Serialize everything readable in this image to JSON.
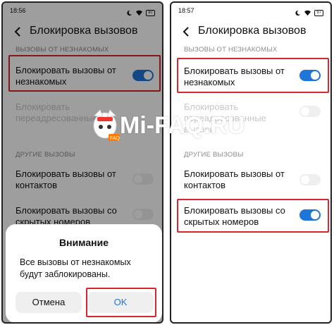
{
  "left_screen": {
    "status": {
      "time": "18:56",
      "battery": "97"
    },
    "title": "Блокировка вызовов",
    "section_unknown": "ВЫЗОВЫ ОТ НЕЗНАКОМЫХ",
    "block_unknown_label": "Блокировать вызовы от незнакомых",
    "block_unknown_on": true,
    "forwarded_label": "Блокировать переадресованные",
    "section_other": "ДРУГИЕ ВЫЗОВЫ",
    "block_contacts_label": "Блокировать вызовы от контактов",
    "block_hidden_label": "Блокировать вызовы со скрытых номеров",
    "dialog": {
      "title": "Внимание",
      "message": "Все вызовы от незнакомых будут заблокированы.",
      "cancel_label": "Отмена",
      "ok_label": "OK"
    }
  },
  "right_screen": {
    "status": {
      "time": "18:57",
      "battery": "97"
    },
    "title": "Блокировка вызовов",
    "section_unknown": "ВЫЗОВЫ ОТ НЕЗНАКОМЫХ",
    "block_unknown_label": "Блокировать вызовы от незнакомых",
    "block_unknown_on": true,
    "forwarded_label": "Блокировать переадресованные вызовы",
    "section_other": "ДРУГИЕ ВЫЗОВЫ",
    "block_contacts_label": "Блокировать вызовы от контактов",
    "block_contacts_on": false,
    "block_hidden_label": "Блокировать вызовы со скрытых номеров",
    "block_hidden_on": true
  },
  "watermark": {
    "text": "Mi-FAQ.RU",
    "badge": "FAQ"
  },
  "colors": {
    "accent": "#1f75d8",
    "highlight": "#d7262e"
  }
}
